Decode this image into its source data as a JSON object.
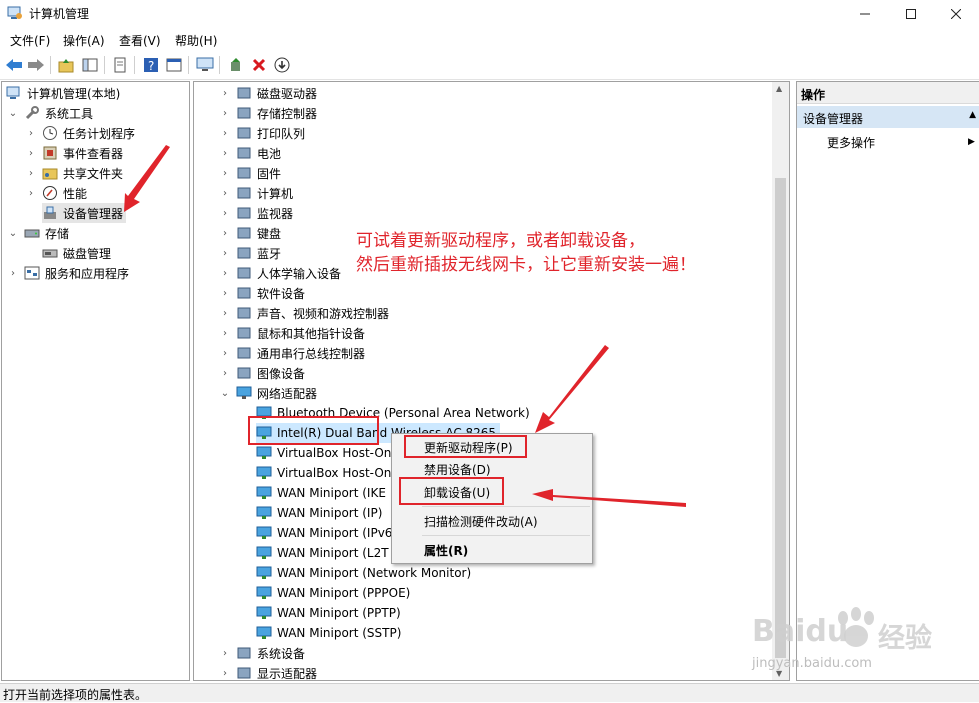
{
  "window": {
    "title": "计算机管理"
  },
  "menu": [
    "文件(F)",
    "操作(A)",
    "查看(V)",
    "帮助(H)"
  ],
  "left_tree": {
    "root": "计算机管理(本地)",
    "system_tools": "系统工具",
    "task_scheduler": "任务计划程序",
    "event_viewer": "事件查看器",
    "shared_folders": "共享文件夹",
    "performance": "性能",
    "device_manager": "设备管理器",
    "storage": "存储",
    "disk_management": "磁盘管理",
    "services_apps": "服务和应用程序"
  },
  "devices": {
    "categories_top": [
      "磁盘驱动器",
      "存储控制器",
      "打印队列",
      "电池",
      "固件",
      "计算机",
      "监视器",
      "键盘",
      "蓝牙",
      "人体学输入设备",
      "软件设备",
      "声音、视频和游戏控制器",
      "鼠标和其他指针设备",
      "通用串行总线控制器",
      "图像设备"
    ],
    "network_adapters": "网络适配器",
    "adapters": [
      "Bluetooth Device (Personal Area Network)",
      "Intel(R) Dual Band Wireless-AC 8265",
      "VirtualBox Host-On",
      "VirtualBox Host-On",
      "WAN Miniport (IKE",
      "WAN Miniport (IP)",
      "WAN Miniport (IPv6",
      "WAN Miniport (L2T",
      "WAN Miniport (Network Monitor)",
      "WAN Miniport (PPPOE)",
      "WAN Miniport (PPTP)",
      "WAN Miniport (SSTP)"
    ],
    "categories_bottom": [
      "系统设备",
      "显示适配器"
    ]
  },
  "context_menu": {
    "update_driver": "更新驱动程序(P)",
    "disable_device": "禁用设备(D)",
    "uninstall_device": "卸载设备(U)",
    "scan_hardware": "扫描检测硬件改动(A)",
    "properties": "属性(R)"
  },
  "annotation": {
    "line1": "可试着更新驱动程序，或者卸载设备，",
    "line2": "然后重新插拔无线网卡，让它重新安装一遍！",
    "color": "#e0242b"
  },
  "actions": {
    "header": "操作",
    "section": "设备管理器",
    "more": "更多操作"
  },
  "status": {
    "text": "打开当前选择项的属性表。"
  },
  "watermark": {
    "brand": "Baidu",
    "brand_cn": "经验",
    "url": "jingyan.baidu.com"
  }
}
